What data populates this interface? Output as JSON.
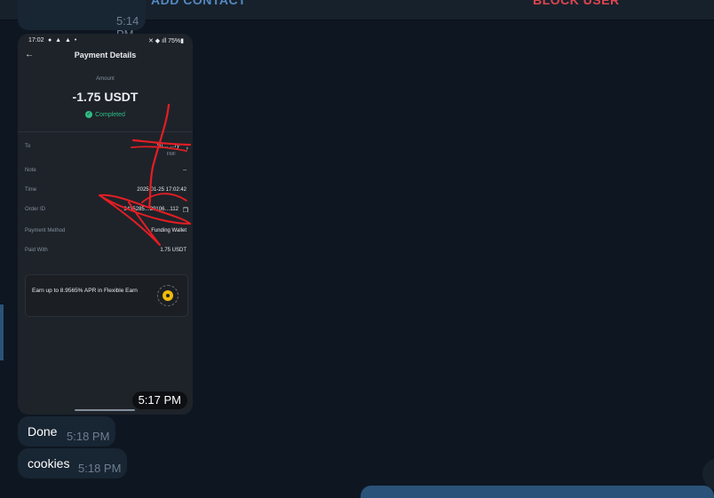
{
  "header": {
    "add_contact_label": "ADD CONTACT",
    "block_user_label": "BLOCK USER"
  },
  "previous_message": {
    "time": "5:14 PM"
  },
  "photo_message": {
    "time": "5:17 PM",
    "screenshot": {
      "status_bar": {
        "time": "17:02",
        "icons": "● ▲ ▲ •",
        "right": "✕ ◆ ıll 75%▮"
      },
      "title": "Payment Details",
      "amount_label": "Amount",
      "amount_value": "-1.75 USDT",
      "status": "Completed",
      "rows": [
        {
          "label": "To",
          "value": "Yu…  …ry",
          "sub": "FMF"
        },
        {
          "label": "Note",
          "value": "--"
        },
        {
          "label": "Time",
          "value": "2025-01-25 17:02:42"
        },
        {
          "label": "Order ID",
          "value": "3435285…29106…112"
        },
        {
          "label": "Payment Method",
          "value": "Funding Wallet"
        },
        {
          "label": "Paid With",
          "value": "1.75 USDT"
        }
      ],
      "earn_card_text": "Earn up to 8.9565% APR in Flexible Earn"
    }
  },
  "messages": [
    {
      "text": "Done",
      "time": "5:18 PM"
    },
    {
      "text": "cookies",
      "time": "5:18 PM"
    }
  ],
  "colors": {
    "background": "#0e1621",
    "bubble": "#182533",
    "accent_blue": "#5288c1",
    "danger_red": "#e0454f",
    "completed_green": "#2ebd85",
    "scribble_red": "#e31e24"
  }
}
